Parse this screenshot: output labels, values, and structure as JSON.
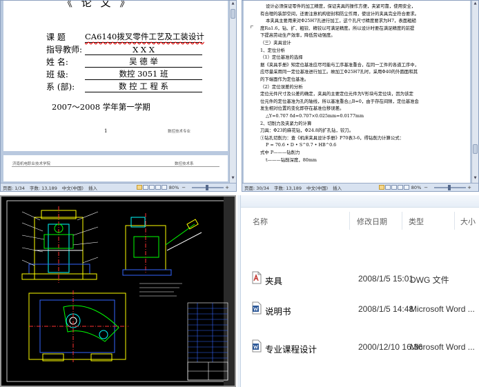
{
  "panel1": {
    "cover_title_fragment": "《 论 文 》",
    "fields": [
      {
        "label": "课      题",
        "value": "CA6140拨叉零件工艺及工装设计",
        "spellcheck": true
      },
      {
        "label": "指导教师:",
        "value": "X    X    X",
        "spellcheck": false
      },
      {
        "label": "姓      名:",
        "value": "吴 德 举",
        "spellcheck": false
      },
      {
        "label": "班      级:",
        "value": "数控 3051 班",
        "spellcheck": false
      },
      {
        "label": "系  (部):",
        "value": "数 控 工 程 系",
        "spellcheck": false
      }
    ],
    "semester": "2007～2008 学年第一学期",
    "page_number": "1",
    "footer_right": "数控技术专业",
    "next_page_header_left": "济南机电职业技术学院",
    "next_page_header_right": "数控技术系",
    "status": {
      "page": "页面: 1/34",
      "words": "字数: 13,189",
      "lang": "中文(中国)",
      "insert": "插入",
      "zoom": "80%"
    }
  },
  "panel2": {
    "lines": [
      {
        "text": "设计必须保证零件的加工精度，保证夹具的操作方便，夹紧可靠，使用安全，",
        "indent": true
      },
      {
        "text": "有合理的装卸空间，还要注意机构密封和防尘作用，使设计的夹具完全符合要求。",
        "indent": false
      },
      {
        "text": "本夹具主要用来对Φ25H7孔进行加工，这个孔尺寸精度要求为H7，表面粗糙",
        "indent": true
      },
      {
        "text": "度Ra1.6，钻、扩、粗铰、精铰以可满足精度。所以设计时要在满足精度的前提",
        "indent": false
      },
      {
        "text": "下提高劳动生产效率，降低劳动强度。",
        "indent": false
      },
      {
        "text": "（三）夹具设计",
        "indent": false
      },
      {
        "text": "1、定位分析",
        "indent": false
      },
      {
        "text": "（1）定位基准的选择",
        "indent": false
      },
      {
        "text": "据《夹具手册》知定位基准应尽可能与工序基准重合，在同一工件的各道工序中，",
        "indent": false
      },
      {
        "text": "应尽量采用同一定位基准进行加工。故加工Φ25H7孔时，采用Φ40的外圆面和其",
        "indent": false
      },
      {
        "text": "的下端面作为定位基准。",
        "indent": false
      },
      {
        "text": "（2）定位误差的分析",
        "indent": false
      },
      {
        "text": "定位元件尺寸及公差的确定，夹具的主要定位元件为V形块与定位块，因为该定",
        "indent": false
      },
      {
        "text": "位元件的定位基准为孔的轴线，所以基准重合△B=0，由于存在间隙，定位基准会",
        "indent": false
      },
      {
        "text": "发生相对位置的变化即存在基准位移误差。",
        "indent": false
      },
      {
        "text": "△Y=0.707 δd=0.707×0.025mm=0.0177mm",
        "indent": true
      },
      {
        "text": "2、切削力及夹紧力的计算",
        "indent": false
      },
      {
        "text": "刀具：Φ23的麻花钻，Φ24.8的扩孔钻，铰刀。",
        "indent": false
      },
      {
        "text": "①钻孔切削力：查《机床夹具设计手册》P70表3-6，得钻削力计算公式：",
        "indent": false
      },
      {
        "text": "P = 70.6 • D • S^0.7 • HB^0.6",
        "indent": true
      },
      {
        "text": "式中   P———钻削力",
        "indent": false
      },
      {
        "text": "t———钻削深度，80mm",
        "indent": true
      }
    ],
    "status": {
      "page": "页面: 30/34",
      "words": "字数: 13,189",
      "lang": "中文(中国)",
      "insert": "插入",
      "zoom": "80%"
    }
  },
  "panel4": {
    "columns": {
      "name": "名称",
      "date": "修改日期",
      "type": "类型",
      "size": "大小"
    },
    "files": [
      {
        "name": "夹具",
        "date": "2008/1/5 15:01",
        "type": "DWG 文件",
        "icon": "dwg-file-icon"
      },
      {
        "name": "说明书",
        "date": "2008/1/5 14:48",
        "type": "Microsoft Word ...",
        "icon": "word-file-icon"
      },
      {
        "name": "专业课程设计",
        "date": "2000/12/10 16:36",
        "type": "Microsoft Word ...",
        "icon": "word-file-icon"
      }
    ]
  },
  "colors": {
    "office_blue": "#b9c9df",
    "cad_background": "#000000",
    "cad_yellow": "#ffff00",
    "cad_green": "#00ff00",
    "cad_blue": "#3366ff",
    "cad_cyan": "#00ffff",
    "cad_red": "#ff3030",
    "spell_red": "#e00000"
  }
}
